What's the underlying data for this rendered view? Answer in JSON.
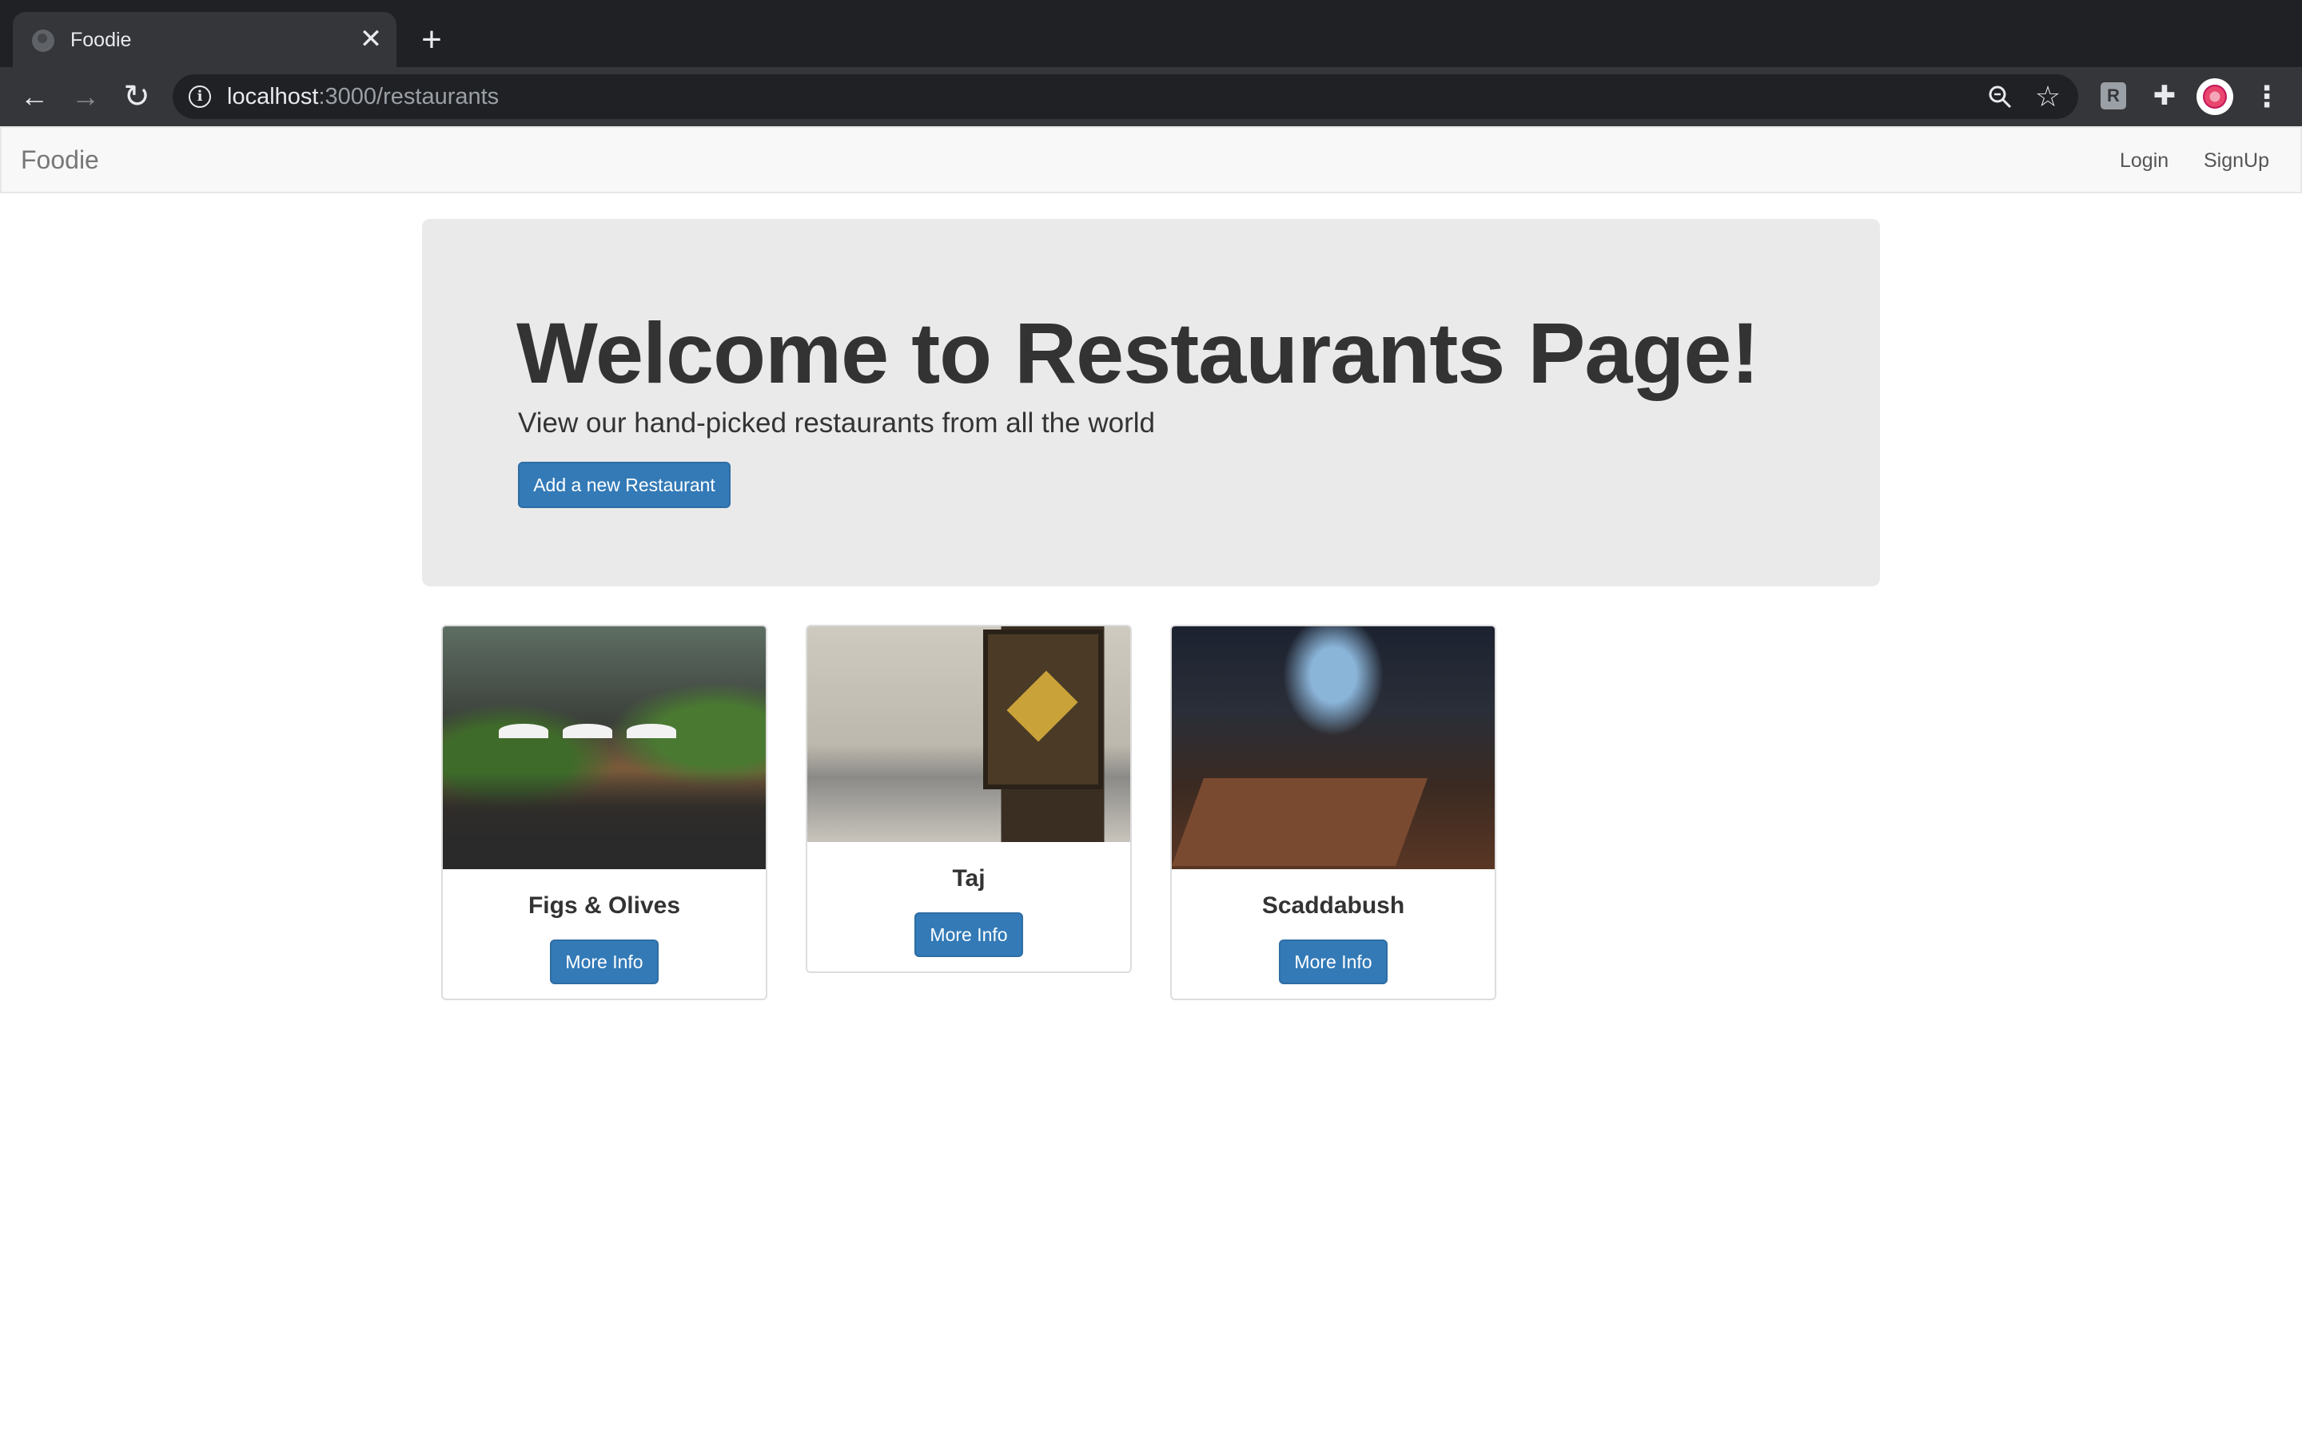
{
  "browser": {
    "tab_title": "Foodie",
    "tab_close": "✕",
    "new_tab": "+",
    "url_host": "localhost",
    "url_path": ":3000/restaurants"
  },
  "navbar": {
    "brand": "Foodie",
    "login": "Login",
    "signup": "SignUp"
  },
  "jumbotron": {
    "title": "Welcome to Restaurants Page!",
    "subtitle": "View our hand-picked restaurants from all the world",
    "add_button": "Add a new Restaurant"
  },
  "restaurants": [
    {
      "name": "Figs & Olives",
      "button": "More Info",
      "image": "restaurant-photo-outdoor-patio"
    },
    {
      "name": "Taj",
      "button": "More Info",
      "image": "restaurant-photo-dining-room-tapestry"
    },
    {
      "name": "Scaddabush",
      "button": "More Info",
      "image": "restaurant-photo-interior-bar"
    }
  ],
  "icons": {
    "back": "arrow-left-icon",
    "forward": "arrow-right-icon",
    "reload": "reload-icon",
    "info": "info-icon",
    "zoom": "zoom-icon",
    "bookmark": "star-icon",
    "extension": "extension-icon",
    "extensions_menu": "puzzle-icon",
    "profile": "profile-avatar",
    "menu": "kebab-menu-icon"
  },
  "colors": {
    "primary_button": "#337ab7",
    "jumbotron_bg": "#eaeaea",
    "navbar_bg": "#f8f8f8",
    "chrome_dark": "#202124"
  }
}
